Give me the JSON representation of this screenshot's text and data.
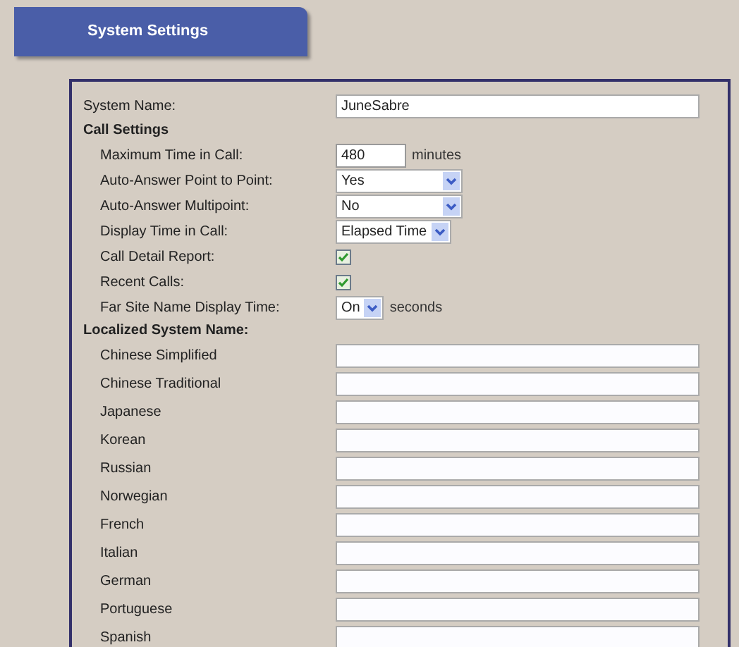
{
  "tab": {
    "title": "System Settings"
  },
  "system_name": {
    "label": "System Name:",
    "value": "JuneSabre"
  },
  "call_settings": {
    "title": "Call Settings",
    "rows": [
      {
        "kind": "number",
        "label": "Maximum Time in Call:",
        "value": "480",
        "unit": "minutes"
      },
      {
        "kind": "select",
        "label": "Auto-Answer Point to Point:",
        "value": "Yes"
      },
      {
        "kind": "select",
        "label": "Auto-Answer Multipoint:",
        "value": "No"
      },
      {
        "kind": "select",
        "label": "Display Time in Call:",
        "value": "Elapsed Time"
      },
      {
        "kind": "checkbox",
        "label": "Call Detail Report:",
        "checked": true
      },
      {
        "kind": "checkbox",
        "label": "Recent Calls:",
        "checked": true
      },
      {
        "kind": "select",
        "label": "Far Site Name Display Time:",
        "value": "On",
        "unit": "seconds"
      }
    ]
  },
  "localized": {
    "title": "Localized System Name:",
    "rows": [
      {
        "label": "Chinese Simplified"
      },
      {
        "label": "Chinese Traditional"
      },
      {
        "label": "Japanese"
      },
      {
        "label": "Korean"
      },
      {
        "label": "Russian"
      },
      {
        "label": "Norwegian"
      },
      {
        "label": "French"
      },
      {
        "label": "Italian"
      },
      {
        "label": "German"
      },
      {
        "label": "Portuguese"
      },
      {
        "label": "Spanish"
      }
    ]
  }
}
